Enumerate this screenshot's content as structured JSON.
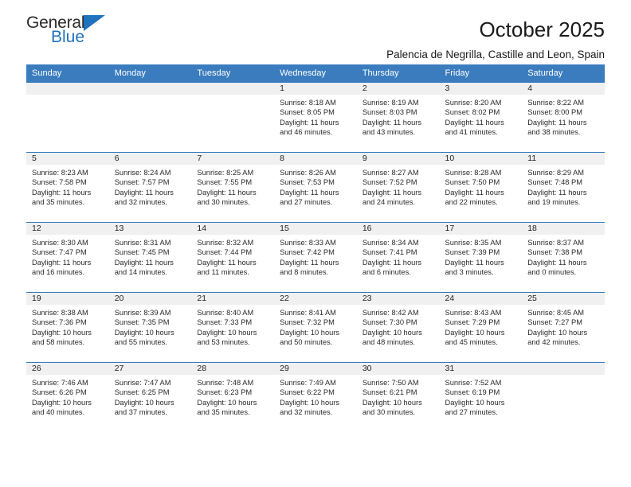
{
  "brand": {
    "name_part1": "General",
    "name_part2": "Blue",
    "triangle_color": "#1f72bd"
  },
  "header": {
    "title": "October 2025",
    "subtitle": "Palencia de Negrilla, Castille and Leon, Spain"
  },
  "theme": {
    "header_bg": "#3a7cbe",
    "daynum_bg": "#f0f0f0",
    "border": "#3a7cbe"
  },
  "weekday_headers": [
    "Sunday",
    "Monday",
    "Tuesday",
    "Wednesday",
    "Thursday",
    "Friday",
    "Saturday"
  ],
  "weeks": [
    [
      {
        "day": "",
        "sunrise": "",
        "sunset": "",
        "daylight_line1": "",
        "daylight_line2": "",
        "empty": true
      },
      {
        "day": "",
        "sunrise": "",
        "sunset": "",
        "daylight_line1": "",
        "daylight_line2": "",
        "empty": true
      },
      {
        "day": "",
        "sunrise": "",
        "sunset": "",
        "daylight_line1": "",
        "daylight_line2": "",
        "empty": true
      },
      {
        "day": "1",
        "sunrise": "Sunrise: 8:18 AM",
        "sunset": "Sunset: 8:05 PM",
        "daylight_line1": "Daylight: 11 hours",
        "daylight_line2": "and 46 minutes."
      },
      {
        "day": "2",
        "sunrise": "Sunrise: 8:19 AM",
        "sunset": "Sunset: 8:03 PM",
        "daylight_line1": "Daylight: 11 hours",
        "daylight_line2": "and 43 minutes."
      },
      {
        "day": "3",
        "sunrise": "Sunrise: 8:20 AM",
        "sunset": "Sunset: 8:02 PM",
        "daylight_line1": "Daylight: 11 hours",
        "daylight_line2": "and 41 minutes."
      },
      {
        "day": "4",
        "sunrise": "Sunrise: 8:22 AM",
        "sunset": "Sunset: 8:00 PM",
        "daylight_line1": "Daylight: 11 hours",
        "daylight_line2": "and 38 minutes."
      }
    ],
    [
      {
        "day": "5",
        "sunrise": "Sunrise: 8:23 AM",
        "sunset": "Sunset: 7:58 PM",
        "daylight_line1": "Daylight: 11 hours",
        "daylight_line2": "and 35 minutes."
      },
      {
        "day": "6",
        "sunrise": "Sunrise: 8:24 AM",
        "sunset": "Sunset: 7:57 PM",
        "daylight_line1": "Daylight: 11 hours",
        "daylight_line2": "and 32 minutes."
      },
      {
        "day": "7",
        "sunrise": "Sunrise: 8:25 AM",
        "sunset": "Sunset: 7:55 PM",
        "daylight_line1": "Daylight: 11 hours",
        "daylight_line2": "and 30 minutes."
      },
      {
        "day": "8",
        "sunrise": "Sunrise: 8:26 AM",
        "sunset": "Sunset: 7:53 PM",
        "daylight_line1": "Daylight: 11 hours",
        "daylight_line2": "and 27 minutes."
      },
      {
        "day": "9",
        "sunrise": "Sunrise: 8:27 AM",
        "sunset": "Sunset: 7:52 PM",
        "daylight_line1": "Daylight: 11 hours",
        "daylight_line2": "and 24 minutes."
      },
      {
        "day": "10",
        "sunrise": "Sunrise: 8:28 AM",
        "sunset": "Sunset: 7:50 PM",
        "daylight_line1": "Daylight: 11 hours",
        "daylight_line2": "and 22 minutes."
      },
      {
        "day": "11",
        "sunrise": "Sunrise: 8:29 AM",
        "sunset": "Sunset: 7:48 PM",
        "daylight_line1": "Daylight: 11 hours",
        "daylight_line2": "and 19 minutes."
      }
    ],
    [
      {
        "day": "12",
        "sunrise": "Sunrise: 8:30 AM",
        "sunset": "Sunset: 7:47 PM",
        "daylight_line1": "Daylight: 11 hours",
        "daylight_line2": "and 16 minutes."
      },
      {
        "day": "13",
        "sunrise": "Sunrise: 8:31 AM",
        "sunset": "Sunset: 7:45 PM",
        "daylight_line1": "Daylight: 11 hours",
        "daylight_line2": "and 14 minutes."
      },
      {
        "day": "14",
        "sunrise": "Sunrise: 8:32 AM",
        "sunset": "Sunset: 7:44 PM",
        "daylight_line1": "Daylight: 11 hours",
        "daylight_line2": "and 11 minutes."
      },
      {
        "day": "15",
        "sunrise": "Sunrise: 8:33 AM",
        "sunset": "Sunset: 7:42 PM",
        "daylight_line1": "Daylight: 11 hours",
        "daylight_line2": "and 8 minutes."
      },
      {
        "day": "16",
        "sunrise": "Sunrise: 8:34 AM",
        "sunset": "Sunset: 7:41 PM",
        "daylight_line1": "Daylight: 11 hours",
        "daylight_line2": "and 6 minutes."
      },
      {
        "day": "17",
        "sunrise": "Sunrise: 8:35 AM",
        "sunset": "Sunset: 7:39 PM",
        "daylight_line1": "Daylight: 11 hours",
        "daylight_line2": "and 3 minutes."
      },
      {
        "day": "18",
        "sunrise": "Sunrise: 8:37 AM",
        "sunset": "Sunset: 7:38 PM",
        "daylight_line1": "Daylight: 11 hours",
        "daylight_line2": "and 0 minutes."
      }
    ],
    [
      {
        "day": "19",
        "sunrise": "Sunrise: 8:38 AM",
        "sunset": "Sunset: 7:36 PM",
        "daylight_line1": "Daylight: 10 hours",
        "daylight_line2": "and 58 minutes."
      },
      {
        "day": "20",
        "sunrise": "Sunrise: 8:39 AM",
        "sunset": "Sunset: 7:35 PM",
        "daylight_line1": "Daylight: 10 hours",
        "daylight_line2": "and 55 minutes."
      },
      {
        "day": "21",
        "sunrise": "Sunrise: 8:40 AM",
        "sunset": "Sunset: 7:33 PM",
        "daylight_line1": "Daylight: 10 hours",
        "daylight_line2": "and 53 minutes."
      },
      {
        "day": "22",
        "sunrise": "Sunrise: 8:41 AM",
        "sunset": "Sunset: 7:32 PM",
        "daylight_line1": "Daylight: 10 hours",
        "daylight_line2": "and 50 minutes."
      },
      {
        "day": "23",
        "sunrise": "Sunrise: 8:42 AM",
        "sunset": "Sunset: 7:30 PM",
        "daylight_line1": "Daylight: 10 hours",
        "daylight_line2": "and 48 minutes."
      },
      {
        "day": "24",
        "sunrise": "Sunrise: 8:43 AM",
        "sunset": "Sunset: 7:29 PM",
        "daylight_line1": "Daylight: 10 hours",
        "daylight_line2": "and 45 minutes."
      },
      {
        "day": "25",
        "sunrise": "Sunrise: 8:45 AM",
        "sunset": "Sunset: 7:27 PM",
        "daylight_line1": "Daylight: 10 hours",
        "daylight_line2": "and 42 minutes."
      }
    ],
    [
      {
        "day": "26",
        "sunrise": "Sunrise: 7:46 AM",
        "sunset": "Sunset: 6:26 PM",
        "daylight_line1": "Daylight: 10 hours",
        "daylight_line2": "and 40 minutes."
      },
      {
        "day": "27",
        "sunrise": "Sunrise: 7:47 AM",
        "sunset": "Sunset: 6:25 PM",
        "daylight_line1": "Daylight: 10 hours",
        "daylight_line2": "and 37 minutes."
      },
      {
        "day": "28",
        "sunrise": "Sunrise: 7:48 AM",
        "sunset": "Sunset: 6:23 PM",
        "daylight_line1": "Daylight: 10 hours",
        "daylight_line2": "and 35 minutes."
      },
      {
        "day": "29",
        "sunrise": "Sunrise: 7:49 AM",
        "sunset": "Sunset: 6:22 PM",
        "daylight_line1": "Daylight: 10 hours",
        "daylight_line2": "and 32 minutes."
      },
      {
        "day": "30",
        "sunrise": "Sunrise: 7:50 AM",
        "sunset": "Sunset: 6:21 PM",
        "daylight_line1": "Daylight: 10 hours",
        "daylight_line2": "and 30 minutes."
      },
      {
        "day": "31",
        "sunrise": "Sunrise: 7:52 AM",
        "sunset": "Sunset: 6:19 PM",
        "daylight_line1": "Daylight: 10 hours",
        "daylight_line2": "and 27 minutes."
      },
      {
        "day": "",
        "sunrise": "",
        "sunset": "",
        "daylight_line1": "",
        "daylight_line2": "",
        "empty": true
      }
    ]
  ]
}
